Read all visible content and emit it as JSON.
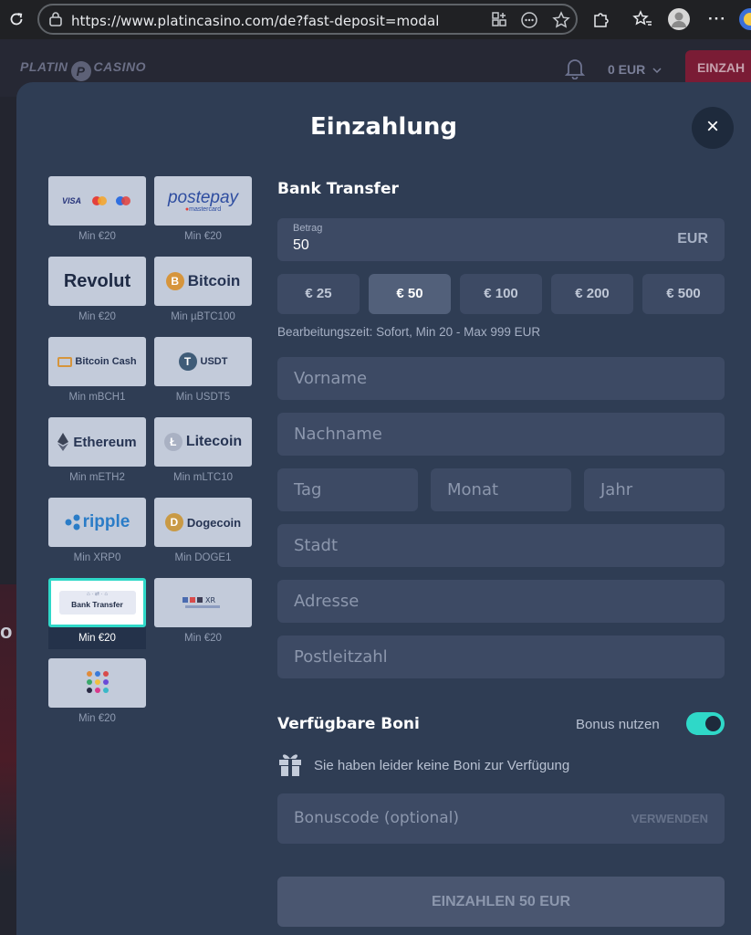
{
  "browser": {
    "url": "https://www.platincasino.com/de?fast-deposit=modal"
  },
  "site": {
    "logo_left": "PLATIN",
    "logo_badge": "P",
    "logo_right": "CASINO",
    "balance": "0 EUR",
    "deposit_button": "EINZAH",
    "bg_text": "o"
  },
  "modal": {
    "title": "Einzahlung",
    "close": "×"
  },
  "methods": [
    {
      "name": "cards",
      "min": "Min €20"
    },
    {
      "name": "postepay",
      "min": "Min €20",
      "logo": "postepay",
      "sub": "mastercard"
    },
    {
      "name": "revolut",
      "min": "Min €20",
      "logo": "Revolut"
    },
    {
      "name": "bitcoin",
      "min": "Min µBTC100",
      "logo": "Bitcoin"
    },
    {
      "name": "bitcoin-cash",
      "min": "Min mBCH1",
      "logo": "Bitcoin Cash"
    },
    {
      "name": "usdt",
      "min": "Min USDT5",
      "logo": "USDT"
    },
    {
      "name": "ethereum",
      "min": "Min mETH2",
      "logo": "Ethereum"
    },
    {
      "name": "litecoin",
      "min": "Min mLTC10",
      "logo": "Litecoin"
    },
    {
      "name": "ripple",
      "min": "Min XRP0",
      "logo": "ripple"
    },
    {
      "name": "dogecoin",
      "min": "Min DOGE1",
      "logo": "Dogecoin"
    },
    {
      "name": "bank-transfer",
      "min": "Min €20",
      "logo": "Bank Transfer"
    },
    {
      "name": "multi",
      "min": "Min €20"
    },
    {
      "name": "multi-banks",
      "min": "Min €20"
    }
  ],
  "deposit": {
    "section_title": "Bank Transfer",
    "amount_label": "Betrag",
    "amount_value": "50",
    "currency": "EUR",
    "presets": [
      "€ 25",
      "€ 50",
      "€ 100",
      "€ 200",
      "€ 500"
    ],
    "active_preset_index": 1,
    "processing_info": "Bearbeitungszeit: Sofort, Min 20 - Max 999 EUR",
    "fields": {
      "first_name": "Vorname",
      "last_name": "Nachname",
      "day": "Tag",
      "month": "Monat",
      "year": "Jahr",
      "city": "Stadt",
      "address": "Adresse",
      "zip": "Postleitzahl"
    }
  },
  "bonus": {
    "title": "Verfügbare Boni",
    "toggle_label": "Bonus nutzen",
    "toggle_on": true,
    "none_text": "Sie haben leider keine Boni zur Verfügung",
    "code_placeholder": "Bonuscode (optional)",
    "apply_label": "VERWENDEN"
  },
  "submit_label": "EINZAHLEN 50 EUR",
  "colors": {
    "modal_bg": "#2f3d54",
    "field_bg": "#3d4a64",
    "accent": "#2fd8c8"
  }
}
